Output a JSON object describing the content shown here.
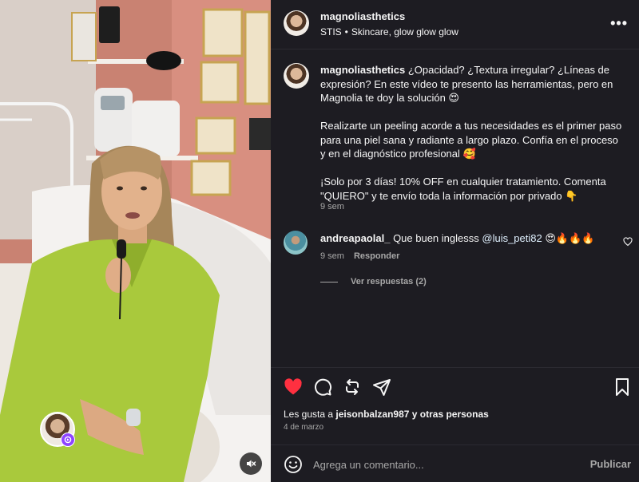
{
  "post": {
    "username": "magnoliasthetics",
    "audio_author": "STIS",
    "audio_title": "Skincare, glow glow glow",
    "more_label": "•••",
    "caption_text": "¿Opacidad? ¿Textura irregular? ¿Líneas de expresión? En este vídeo te presento las herramientas, pero en Magnolia te doy la solución 😍\n\nRealizarte un peeling acorde a tus necesidades es el primer paso para una piel sana y radiante a largo plazo. Confía en el proceso y en el diagnóstico profesional 🥰\n\n¡Solo por 3 días! 10% OFF en cualquier tratamiento. Comenta \"QUIERO\" y te envío toda la información por privado 👇",
    "caption_time": "9 sem"
  },
  "comment": {
    "username": "andreapaolal_",
    "text": "Que buen inglesss",
    "mention": "@luis_peti82",
    "emojis": "😍🔥🔥🔥",
    "time": "9 sem",
    "reply_label": "Responder",
    "view_replies": "Ver respuestas (2)"
  },
  "likes": {
    "prefix": "Les gusta a ",
    "user": "jeisonbalzan987",
    "suffix": " y otras personas"
  },
  "date": "4 de marzo",
  "comment_bar": {
    "placeholder": "Agrega un comentario...",
    "post_label": "Publicar"
  },
  "colors": {
    "panel_bg": "#1d1c22",
    "like_red": "#ff3040",
    "muted_text": "#a8a8a8",
    "mention_color": "#e0f1ff"
  },
  "icons": [
    "heart-icon",
    "comment-icon",
    "repost-icon",
    "share-icon",
    "bookmark-icon",
    "emoji-icon",
    "mute-icon",
    "reel-badge-icon"
  ]
}
